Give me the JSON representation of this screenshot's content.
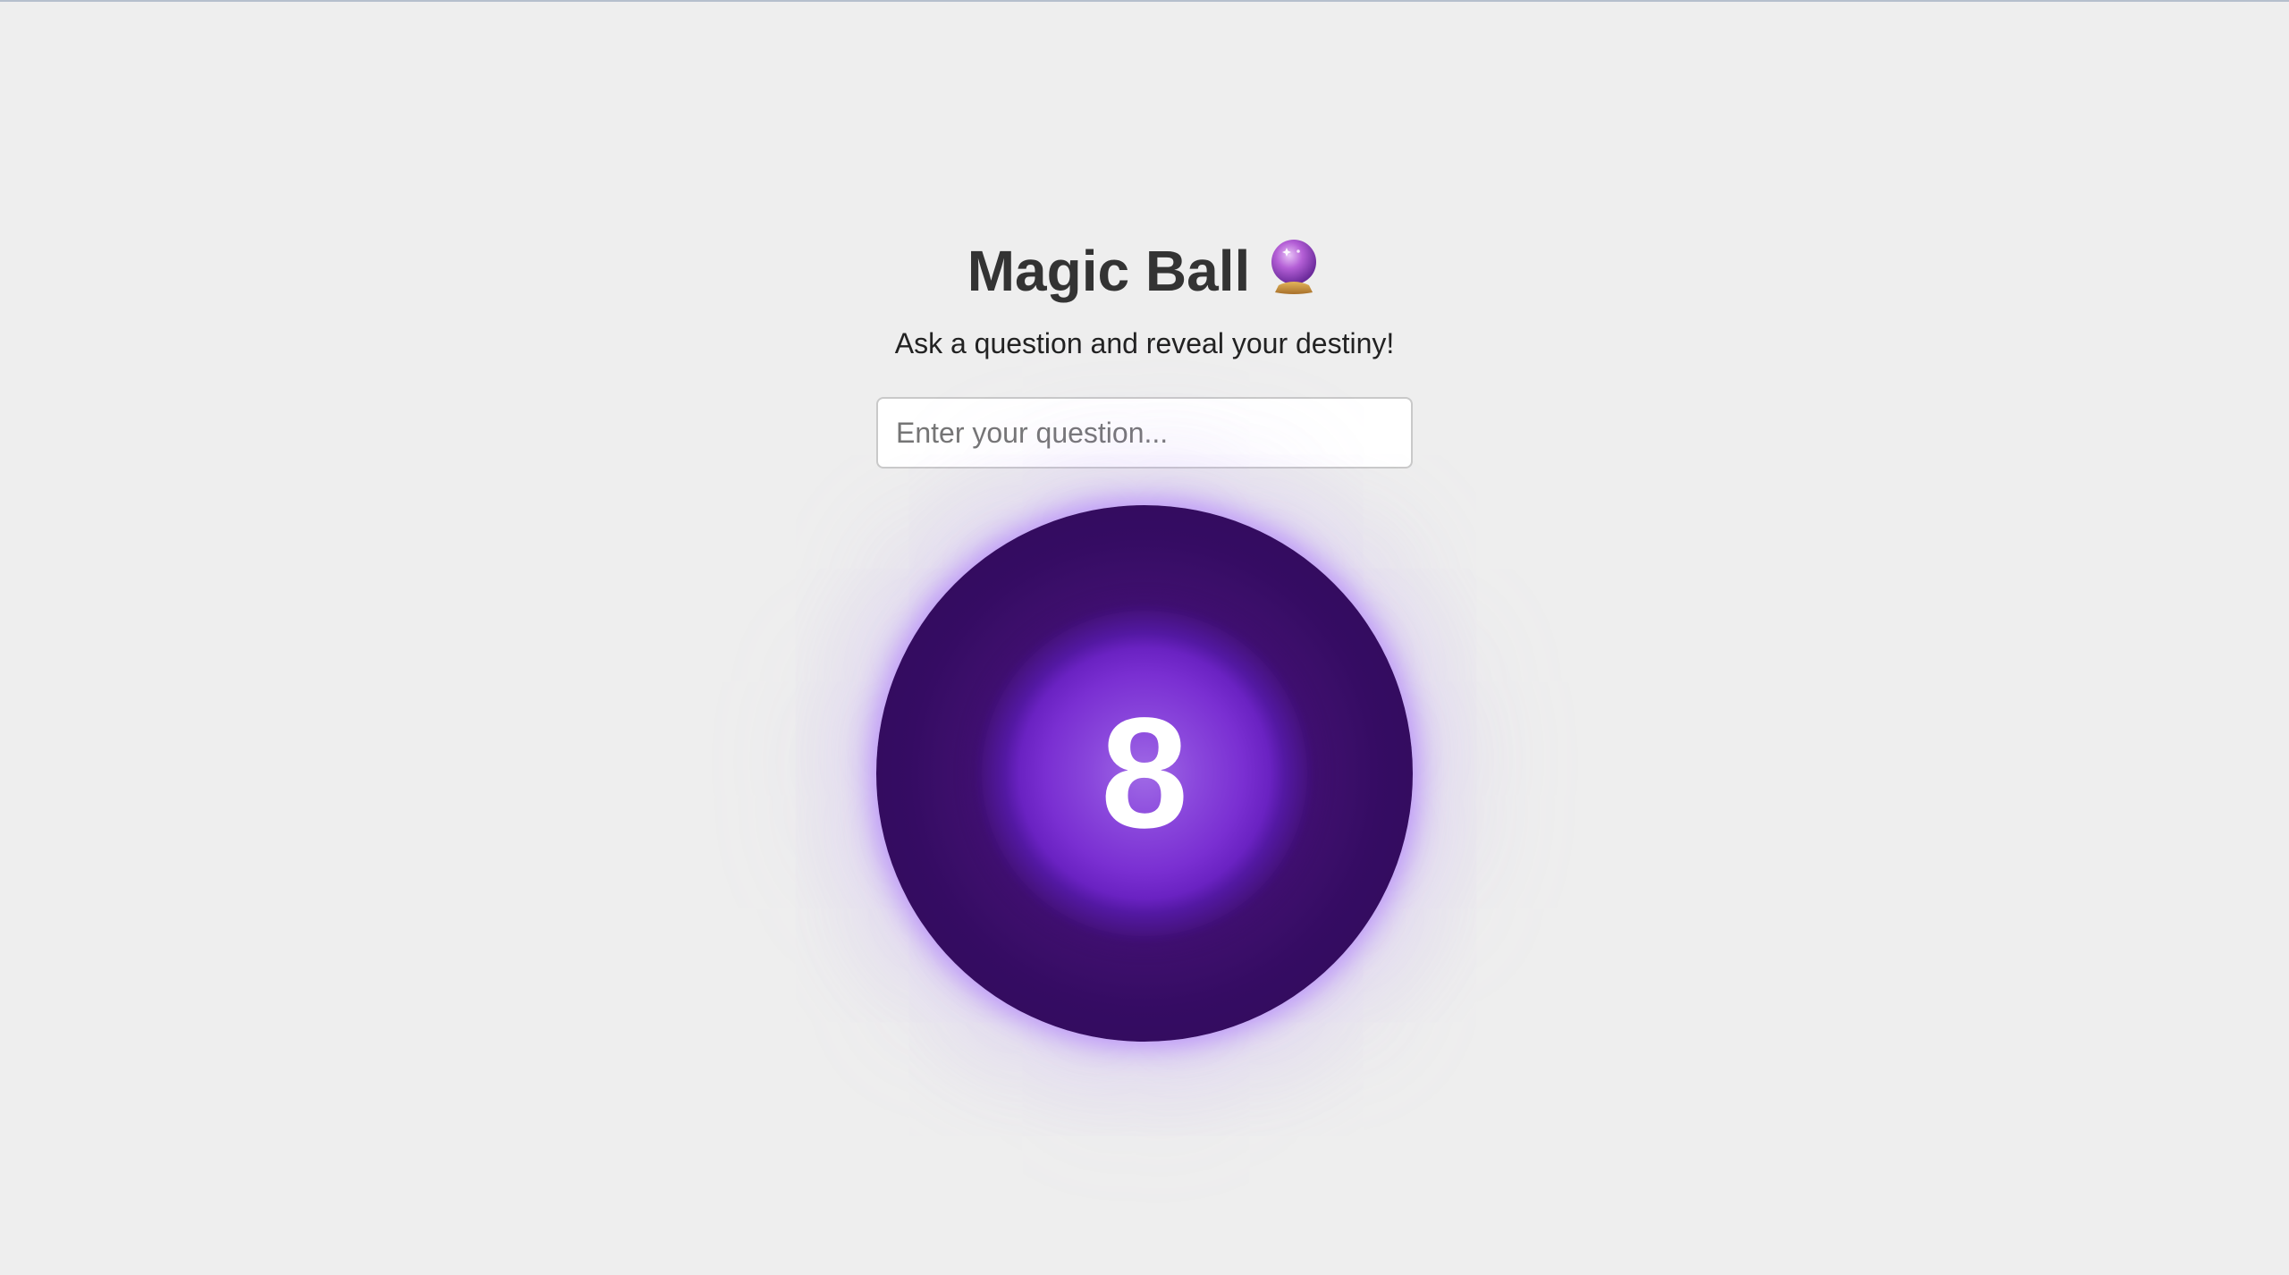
{
  "header": {
    "title": "Magic Ball",
    "title_icon": "crystal-ball-icon"
  },
  "subtitle": "Ask a question and reveal your destiny!",
  "question": {
    "value": "",
    "placeholder": "Enter your question..."
  },
  "ball": {
    "number": "8"
  },
  "colors": {
    "background": "#eeeeee",
    "title": "#333333",
    "ball_center": "#a06ae6",
    "ball_mid": "#7a2fd2",
    "ball_edge": "#2e0a56",
    "glow": "#9c5eff"
  }
}
